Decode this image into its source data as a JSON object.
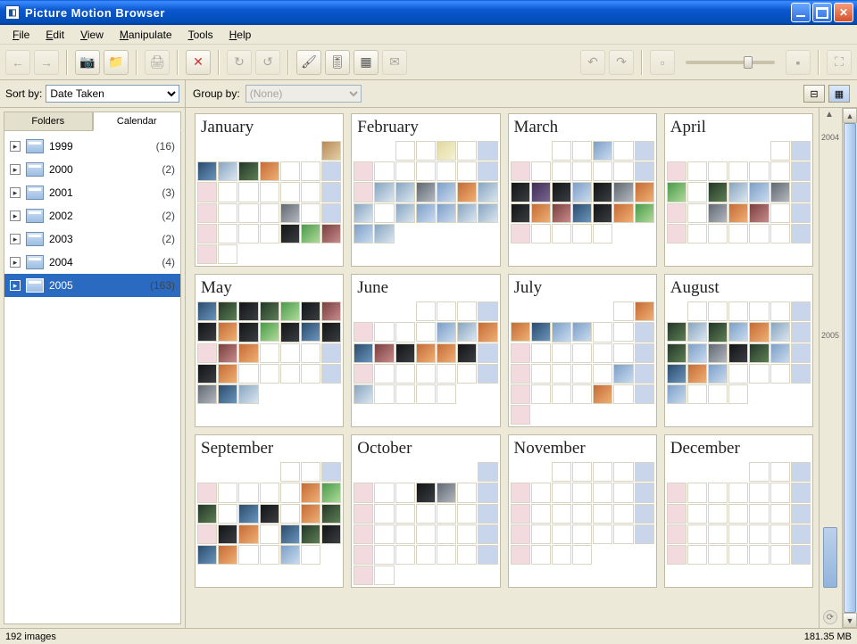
{
  "title": "Picture Motion Browser",
  "menu": [
    "File",
    "Edit",
    "View",
    "Manipulate",
    "Tools",
    "Help"
  ],
  "sidebar": {
    "sort_label": "Sort by:",
    "sort_value": "Date Taken",
    "tabs": {
      "folders": "Folders",
      "calendar": "Calendar"
    },
    "years": [
      {
        "label": "1999",
        "count": "(16)"
      },
      {
        "label": "2000",
        "count": "(2)"
      },
      {
        "label": "2001",
        "count": "(3)"
      },
      {
        "label": "2002",
        "count": "(2)"
      },
      {
        "label": "2003",
        "count": "(2)"
      },
      {
        "label": "2004",
        "count": "(4)"
      },
      {
        "label": "2005",
        "count": "(163)"
      }
    ],
    "selected_index": 6
  },
  "grouprow": {
    "label": "Group by:",
    "value": "(None)"
  },
  "timeline": {
    "labels": [
      "2004",
      "2005"
    ]
  },
  "months": [
    {
      "name": "January",
      "offset": 6,
      "ndays": 31,
      "thumbs": [
        0,
        1,
        2,
        3,
        4,
        -1,
        -1,
        -1,
        -1,
        -1,
        -1,
        -1,
        -1,
        -1,
        -1,
        -1,
        -1,
        -1,
        -1,
        5,
        -1,
        -1,
        -1,
        -1,
        -1,
        -1,
        6,
        7,
        8,
        -1,
        -1
      ]
    },
    {
      "name": "February",
      "offset": 2,
      "ndays": 28,
      "thumbs": [
        -1,
        -1,
        9,
        -1,
        -1,
        -1,
        -1,
        -1,
        -1,
        -1,
        -1,
        -1,
        -1,
        2,
        2,
        5,
        10,
        4,
        2,
        2,
        -1,
        2,
        10,
        10,
        2,
        2,
        10,
        2
      ]
    },
    {
      "name": "March",
      "offset": 2,
      "ndays": 31,
      "thumbs": [
        -1,
        -1,
        10,
        -1,
        -1,
        -1,
        -1,
        -1,
        -1,
        -1,
        -1,
        -1,
        6,
        11,
        6,
        10,
        6,
        5,
        4,
        6,
        4,
        8,
        1,
        6,
        4,
        7,
        -1,
        -1,
        -1,
        -1,
        -1
      ]
    },
    {
      "name": "April",
      "offset": 5,
      "ndays": 30,
      "thumbs": [
        -1,
        -1,
        -1,
        -1,
        -1,
        -1,
        -1,
        -1,
        -1,
        7,
        -1,
        3,
        2,
        10,
        5,
        -1,
        -1,
        -1,
        5,
        4,
        8,
        -1,
        -1,
        -1,
        -1,
        -1,
        -1,
        -1,
        -1,
        -1
      ]
    },
    {
      "name": "May",
      "offset": 0,
      "ndays": 31,
      "thumbs": [
        1,
        3,
        6,
        3,
        7,
        6,
        8,
        6,
        4,
        6,
        7,
        6,
        1,
        6,
        -1,
        8,
        4,
        -1,
        -1,
        -1,
        -1,
        6,
        4,
        -1,
        -1,
        -1,
        -1,
        -1,
        5,
        1,
        2
      ]
    },
    {
      "name": "June",
      "offset": 3,
      "ndays": 30,
      "thumbs": [
        -1,
        -1,
        -1,
        -1,
        -1,
        -1,
        -1,
        -1,
        10,
        2,
        4,
        1,
        8,
        6,
        4,
        4,
        6,
        -1,
        -1,
        -1,
        -1,
        -1,
        -1,
        -1,
        -1,
        2,
        -1,
        -1,
        -1,
        -1
      ]
    },
    {
      "name": "July",
      "offset": 5,
      "ndays": 31,
      "thumbs": [
        -1,
        4,
        4,
        1,
        10,
        10,
        -1,
        -1,
        -1,
        -1,
        -1,
        -1,
        -1,
        -1,
        -1,
        -1,
        -1,
        -1,
        -1,
        -1,
        -1,
        10,
        -1,
        -1,
        -1,
        -1,
        -1,
        4,
        -1,
        -1,
        -1
      ]
    },
    {
      "name": "August",
      "offset": 1,
      "ndays": 31,
      "thumbs": [
        -1,
        -1,
        -1,
        -1,
        -1,
        -1,
        3,
        2,
        3,
        10,
        4,
        2,
        -1,
        3,
        10,
        5,
        6,
        3,
        10,
        -1,
        1,
        4,
        10,
        -1,
        -1,
        -1,
        -1,
        10,
        -1,
        -1,
        -1
      ]
    },
    {
      "name": "September",
      "offset": 4,
      "ndays": 30,
      "thumbs": [
        -1,
        -1,
        -1,
        -1,
        -1,
        -1,
        -1,
        -1,
        4,
        7,
        3,
        -1,
        1,
        6,
        -1,
        4,
        3,
        -1,
        6,
        4,
        -1,
        1,
        3,
        6,
        1,
        4,
        -1,
        -1,
        10,
        -1
      ]
    },
    {
      "name": "October",
      "offset": 6,
      "ndays": 31,
      "thumbs": [
        -1,
        -1,
        -1,
        -1,
        6,
        5,
        -1,
        -1,
        -1,
        -1,
        -1,
        -1,
        -1,
        -1,
        -1,
        -1,
        -1,
        -1,
        -1,
        -1,
        -1,
        -1,
        -1,
        -1,
        -1,
        -1,
        -1,
        -1,
        -1,
        -1,
        -1
      ]
    },
    {
      "name": "November",
      "offset": 2,
      "ndays": 30,
      "thumbs": [
        -1,
        -1,
        -1,
        -1,
        -1,
        -1,
        -1,
        -1,
        -1,
        -1,
        -1,
        -1,
        -1,
        -1,
        -1,
        -1,
        -1,
        -1,
        -1,
        -1,
        -1,
        -1,
        -1,
        -1,
        -1,
        -1,
        -1,
        -1,
        -1,
        -1
      ]
    },
    {
      "name": "December",
      "offset": 4,
      "ndays": 31,
      "thumbs": [
        -1,
        -1,
        -1,
        -1,
        -1,
        -1,
        -1,
        -1,
        -1,
        -1,
        -1,
        -1,
        -1,
        -1,
        -1,
        -1,
        -1,
        -1,
        -1,
        -1,
        -1,
        -1,
        -1,
        -1,
        -1,
        -1,
        -1,
        -1,
        -1,
        -1,
        -1
      ]
    }
  ],
  "status": {
    "left": "192 images",
    "right": "181.35 MB"
  }
}
